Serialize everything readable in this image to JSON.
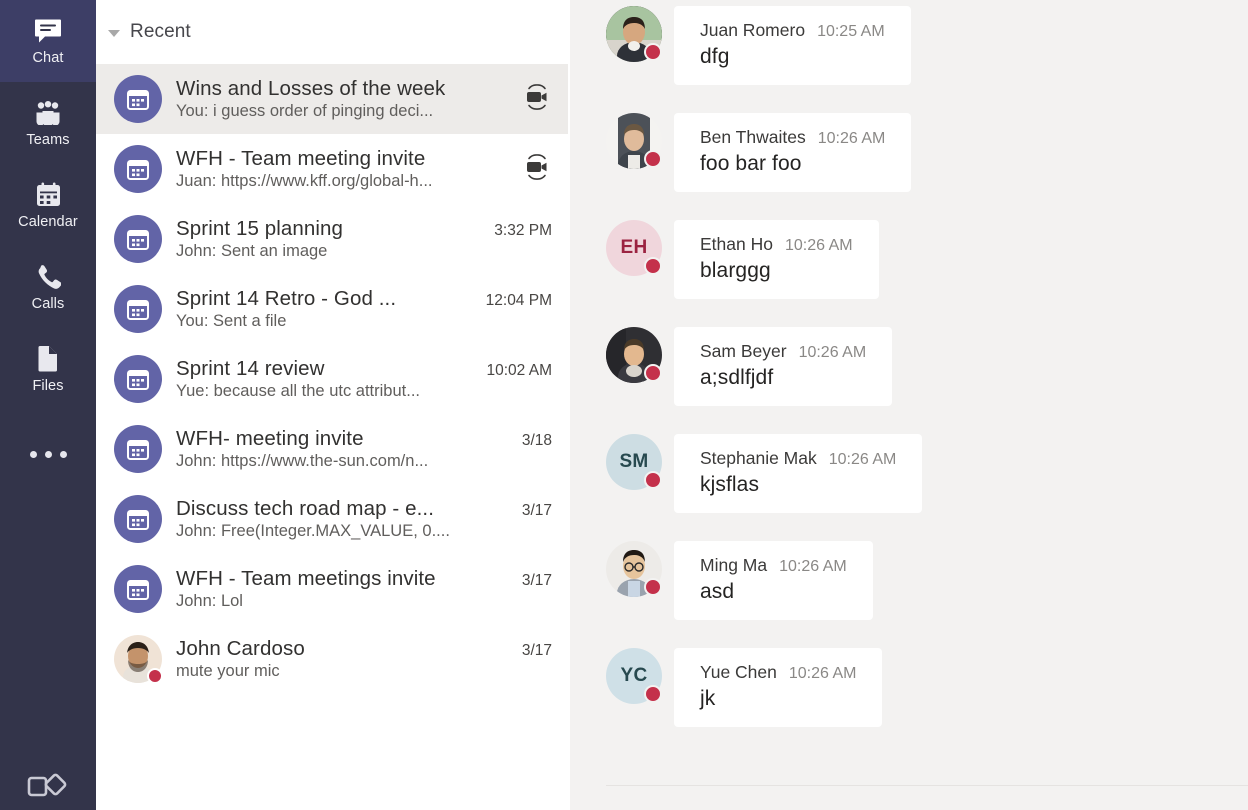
{
  "colors": {
    "rail_bg": "#33344A",
    "rail_active_bg": "#3D3E66",
    "accent_purple": "#6264A7",
    "presence_busy": "#C4314B",
    "pane_bg": "#F3F2F1",
    "selected_row_bg": "#EDEBE9"
  },
  "rail": {
    "items": [
      {
        "label": "Chat",
        "icon": "chat-icon",
        "active": true
      },
      {
        "label": "Teams",
        "icon": "teams-icon",
        "active": false
      },
      {
        "label": "Calendar",
        "icon": "calendar-icon",
        "active": false
      },
      {
        "label": "Calls",
        "icon": "phone-icon",
        "active": false
      },
      {
        "label": "Files",
        "icon": "files-icon",
        "active": false
      }
    ],
    "more_icon": "ellipsis-icon",
    "apps_icon": "apps-icon"
  },
  "list": {
    "header": {
      "title": "Recent",
      "chevron": "chevron-down-icon"
    },
    "rows": [
      {
        "title": "Wins and Losses of the week",
        "preview": "You: i guess order of pinging deci...",
        "time": "",
        "meeting_icon": "video-camera-icon",
        "avatar": "meeting-calendar",
        "selected": true,
        "presence": false
      },
      {
        "title": "WFH - Team meeting invite",
        "preview": "Juan: https://www.kff.org/global-h...",
        "time": "",
        "meeting_icon": "video-camera-icon",
        "avatar": "meeting-calendar",
        "selected": false,
        "presence": false
      },
      {
        "title": "Sprint 15 planning",
        "preview": "John: Sent an image",
        "time": "3:32 PM",
        "meeting_icon": "",
        "avatar": "meeting-calendar",
        "selected": false,
        "presence": false
      },
      {
        "title": "Sprint 14 Retro - God ...",
        "preview": "You: Sent a file",
        "time": "12:04 PM",
        "meeting_icon": "",
        "avatar": "meeting-calendar",
        "selected": false,
        "presence": false
      },
      {
        "title": "Sprint 14 review",
        "preview": "Yue: because all the utc attribut...",
        "time": "10:02 AM",
        "meeting_icon": "",
        "avatar": "meeting-calendar",
        "selected": false,
        "presence": false
      },
      {
        "title": "WFH- meeting invite",
        "preview": "John: https://www.the-sun.com/n...",
        "time": "3/18",
        "meeting_icon": "",
        "avatar": "meeting-calendar",
        "selected": false,
        "presence": false
      },
      {
        "title": "Discuss tech road map - e...",
        "preview": "John: Free(Integer.MAX_VALUE, 0....",
        "time": "3/17",
        "meeting_icon": "",
        "avatar": "meeting-calendar",
        "selected": false,
        "presence": false
      },
      {
        "title": "WFH - Team meetings invite",
        "preview": "John: Lol",
        "time": "3/17",
        "meeting_icon": "",
        "avatar": "meeting-calendar",
        "selected": false,
        "presence": false
      },
      {
        "title": "John Cardoso",
        "preview": "mute your mic",
        "time": "3/17",
        "meeting_icon": "",
        "avatar": "person-photo",
        "selected": false,
        "presence": true
      }
    ]
  },
  "chat": {
    "messages": [
      {
        "name": "Juan Romero",
        "time": "10:25 AM",
        "text": "dfg",
        "avatar_type": "photo",
        "avatar_variant": "juan",
        "initials": "",
        "presence": "busy"
      },
      {
        "name": "Ben Thwaites",
        "time": "10:26 AM",
        "text": "foo bar foo",
        "avatar_type": "photo",
        "avatar_variant": "ben",
        "initials": "",
        "presence": "busy"
      },
      {
        "name": "Ethan Ho",
        "time": "10:26 AM",
        "text": "blarggg",
        "avatar_type": "initials",
        "avatar_variant": "rose",
        "initials": "EH",
        "presence": "busy"
      },
      {
        "name": "Sam Beyer",
        "time": "10:26 AM",
        "text": "a;sdlfjdf",
        "avatar_type": "photo",
        "avatar_variant": "sam",
        "initials": "",
        "presence": "busy"
      },
      {
        "name": "Stephanie Mak",
        "time": "10:26 AM",
        "text": "kjsflas",
        "avatar_type": "initials",
        "avatar_variant": "blue",
        "initials": "SM",
        "presence": "busy"
      },
      {
        "name": "Ming Ma",
        "time": "10:26 AM",
        "text": "asd",
        "avatar_type": "photo",
        "avatar_variant": "ming",
        "initials": "",
        "presence": "busy"
      },
      {
        "name": "Yue Chen",
        "time": "10:26 AM",
        "text": "jk",
        "avatar_type": "initials",
        "avatar_variant": "blue",
        "initials": "YC",
        "presence": "busy"
      }
    ]
  }
}
